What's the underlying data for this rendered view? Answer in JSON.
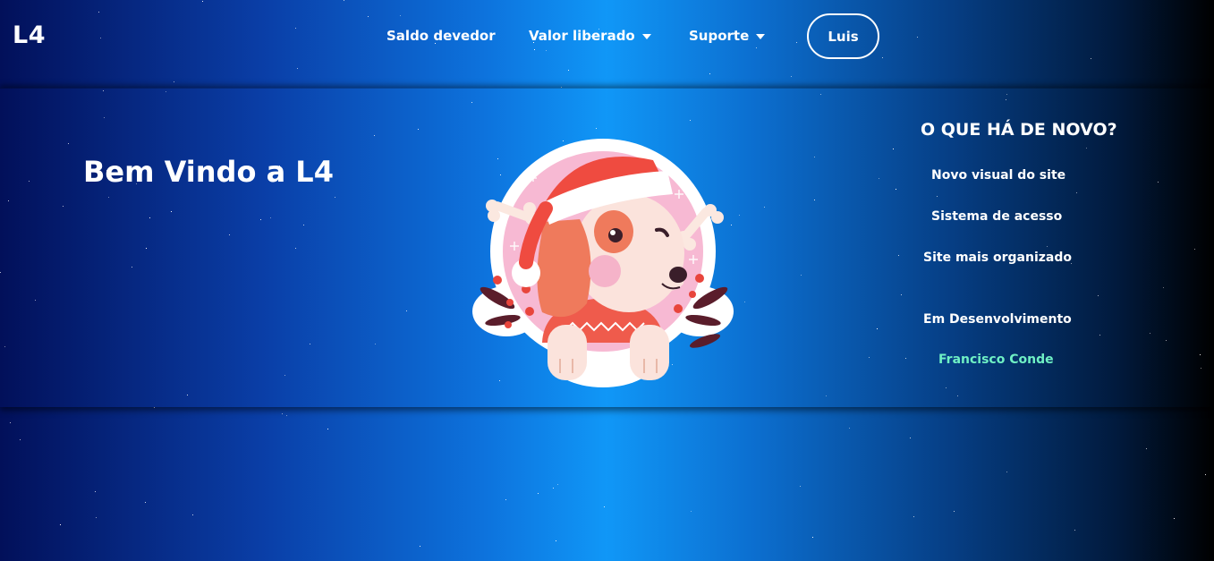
{
  "nav": {
    "logo": "L4",
    "items": [
      {
        "label": "Saldo devedor",
        "has_dropdown": false
      },
      {
        "label": "Valor liberado",
        "has_dropdown": true
      },
      {
        "label": "Suporte",
        "has_dropdown": true
      }
    ],
    "user_button": "Luis"
  },
  "hero": {
    "welcome": "Bem Vindo a L4",
    "mascot_icon": "christmas-dog-icon"
  },
  "news": {
    "title": "O QUE HÁ DE NOVO?",
    "items": [
      "Novo visual do site",
      "Sistema de acesso",
      "Site mais organizado"
    ],
    "status": "Em Desenvolvimento",
    "developer": "Francisco Conde"
  },
  "colors": {
    "developer_accent": "#6ff0c4",
    "gradient_center": "#1097f7",
    "gradient_left": "#02105a",
    "gradient_right": "#000000"
  }
}
